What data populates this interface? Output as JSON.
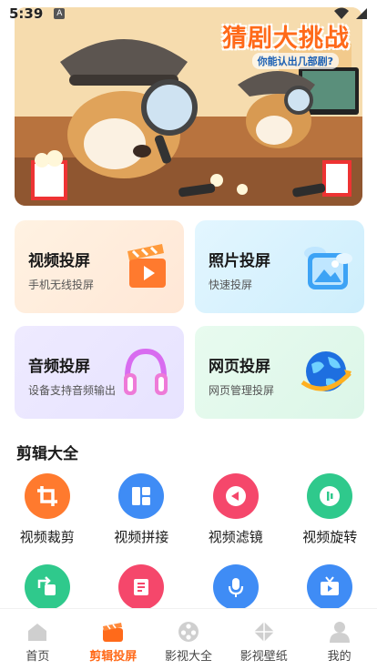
{
  "status_bar": {
    "time": "5:39",
    "notification_icon": "A"
  },
  "banner": {
    "title": "猜剧大挑战",
    "subtitle": "你能认出几部剧?"
  },
  "cards": [
    {
      "title": "视频投屏",
      "subtitle": "手机无线投屏",
      "icon": "clapperboard-icon"
    },
    {
      "title": "照片投屏",
      "subtitle": "快速投屏",
      "icon": "photo-icon"
    },
    {
      "title": "音频投屏",
      "subtitle": "设备支持音频输出",
      "icon": "headphones-icon"
    },
    {
      "title": "网页投屏",
      "subtitle": "网页管理投屏",
      "icon": "globe-icon"
    }
  ],
  "section": {
    "title": "剪辑大全"
  },
  "tools": [
    {
      "label": "视频裁剪",
      "icon": "crop-icon",
      "color": "#ff7a2e"
    },
    {
      "label": "视频拼接",
      "icon": "grid-icon",
      "color": "#3f8cf5"
    },
    {
      "label": "视频滤镜",
      "icon": "filter-icon",
      "color": "#f5476b"
    },
    {
      "label": "视频旋转",
      "icon": "rotate-icon",
      "color": "#2fc98c"
    },
    {
      "label": "",
      "icon": "flip-icon",
      "color": "#2fc98c"
    },
    {
      "label": "",
      "icon": "subtitle-icon",
      "color": "#f5476b"
    },
    {
      "label": "",
      "icon": "mic-icon",
      "color": "#3f8cf5"
    },
    {
      "label": "",
      "icon": "tv-icon",
      "color": "#3f8cf5"
    }
  ],
  "tabbar": {
    "active_color": "#ff6a1a",
    "items": [
      {
        "label": "首页",
        "icon": "home-icon"
      },
      {
        "label": "剪辑投屏",
        "icon": "clapper-icon"
      },
      {
        "label": "影视大全",
        "icon": "film-reel-icon"
      },
      {
        "label": "影视壁纸",
        "icon": "wallpaper-icon"
      },
      {
        "label": "我的",
        "icon": "user-icon"
      }
    ]
  }
}
